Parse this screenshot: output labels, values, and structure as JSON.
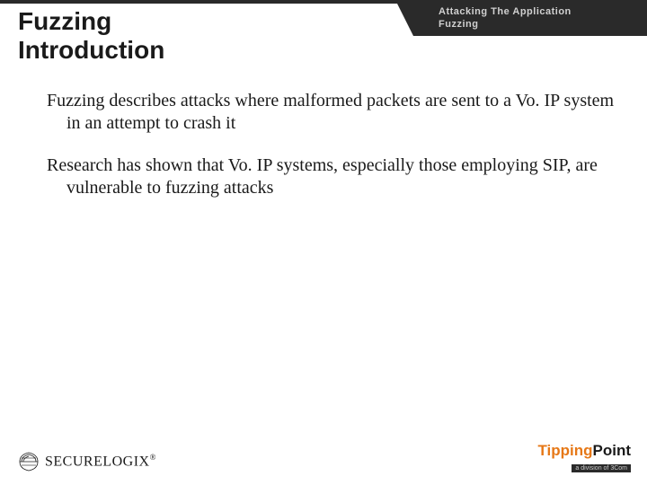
{
  "header": {
    "tab_line1": "Attacking The Application",
    "tab_line2": "Fuzzing"
  },
  "title": "Fuzzing\nIntroduction",
  "paragraphs": [
    "Fuzzing describes attacks where malformed packets are sent to a Vo. IP system in an attempt to crash it",
    "Research has shown that Vo. IP systems, especially those employing SIP, are vulnerable to fuzzing attacks"
  ],
  "footer": {
    "left_logo_text": "SECURELOGIX",
    "left_logo_reg": "®",
    "right_logo_part1": "Tipping",
    "right_logo_part2": "Point",
    "right_logo_sub": "a division of 3Com"
  }
}
